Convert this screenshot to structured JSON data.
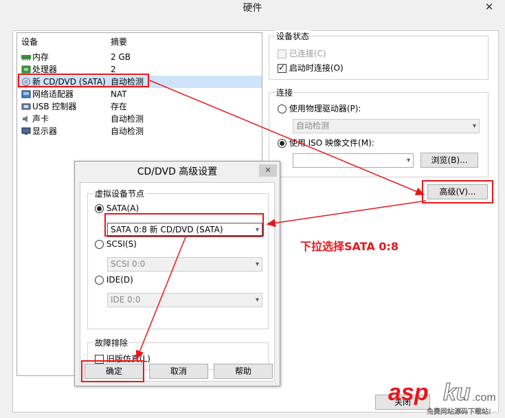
{
  "window": {
    "title": "硬件",
    "close_glyph": "✕"
  },
  "device_list": {
    "col_device": "设备",
    "col_summary": "摘要",
    "items": [
      {
        "name": "内存",
        "summary": "2 GB",
        "icon": "memory-icon"
      },
      {
        "name": "处理器",
        "summary": "2",
        "icon": "processor-icon"
      },
      {
        "name": "新 CD/DVD (SATA)",
        "summary": "自动检测",
        "icon": "cd-dvd-icon",
        "selected": true
      },
      {
        "name": "网络适配器",
        "summary": "NAT",
        "icon": "network-icon"
      },
      {
        "name": "USB 控制器",
        "summary": "存在",
        "icon": "usb-icon"
      },
      {
        "name": "声卡",
        "summary": "自动检测",
        "icon": "sound-icon"
      },
      {
        "name": "显示器",
        "summary": "自动检测",
        "icon": "display-icon"
      }
    ]
  },
  "device_status": {
    "title": "设备状态",
    "connected_label": "已连接(C)",
    "connect_at_power_on_label": "启动时连接(O)"
  },
  "connection": {
    "title": "连接",
    "physical_drive_label": "使用物理驱动器(P):",
    "physical_drive_value": "自动检测",
    "iso_label": "使用 ISO 映像文件(M):",
    "iso_value": "",
    "browse_label": "浏览(B)...",
    "advanced_label": "高级(V)..."
  },
  "dialog": {
    "title": "CD/DVD 高级设置",
    "close_glyph": "✕",
    "node_group_title": "虚拟设备节点",
    "sata_label": "SATA(A)",
    "sata_value": "SATA 0:8    新 CD/DVD (SATA)",
    "scsi_label": "SCSI(S)",
    "scsi_value": "SCSI 0:0",
    "ide_label": "IDE(D)",
    "ide_value": "IDE 0:0",
    "troubleshoot_title": "故障排除",
    "legacy_label": "旧版仿真(L)",
    "ok_label": "确定",
    "cancel_label": "取消",
    "help_label": "帮助"
  },
  "annotation": {
    "text": "下拉选择SATA 0:8",
    "color": "#e8161a"
  },
  "behind_button": {
    "label": "关闭"
  },
  "watermark": {
    "brand": "asp",
    "brand2": "ku",
    "suffix": ".com",
    "sub": "免费网站源码下载站!"
  },
  "colors": {
    "selection": "#cfe4fa",
    "annotation_red": "#e8161a"
  }
}
